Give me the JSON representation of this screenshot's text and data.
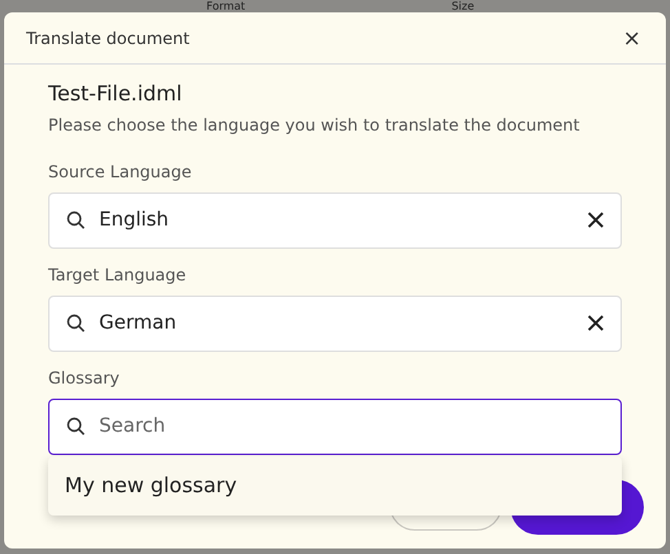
{
  "background": {
    "column_labels": [
      "Format",
      "Size"
    ]
  },
  "dialog": {
    "title": "Translate document",
    "close": "×",
    "file_name": "Test-File.idml",
    "instruction": "Please choose the language you wish to translate the document",
    "fields": [
      {
        "label": "Source Language",
        "value": "English",
        "focused": false,
        "clearable": true
      },
      {
        "label": "Target Language",
        "value": "German",
        "focused": false,
        "clearable": true
      },
      {
        "label": "Glossary",
        "placeholder": "Search",
        "focused": true,
        "clearable": false
      }
    ],
    "dropdown": {
      "items": [
        {
          "label": "My new glossary"
        }
      ]
    },
    "buttons": [
      {
        "kind": "secondary"
      },
      {
        "kind": "primary"
      }
    ]
  }
}
